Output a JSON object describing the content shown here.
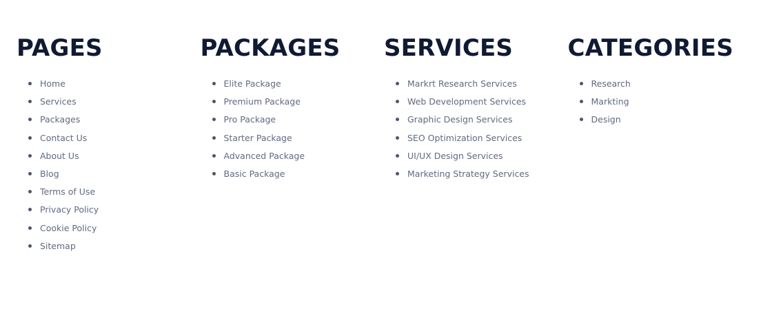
{
  "columns": [
    {
      "title": "PAGES",
      "items": [
        "Home",
        "Services",
        "Packages",
        "Contact Us",
        "About Us",
        "Blog",
        "Terms of Use",
        "Privacy Policy",
        "Cookie Policy",
        "Sitemap"
      ]
    },
    {
      "title": "PACKAGES",
      "items": [
        "Elite Package",
        "Premium Package",
        "Pro Package",
        "Starter Package",
        "Advanced Package",
        "Basic Package"
      ]
    },
    {
      "title": "SERVICES",
      "items": [
        "Markrt Research Services",
        "Web Development Services",
        "Graphic Design Services",
        "SEO Optimization Services",
        "UI/UX Design Services",
        "Marketing Strategy Services"
      ]
    },
    {
      "title": "CATEGORIES",
      "items": [
        "Research",
        "Markting",
        "Design"
      ]
    }
  ],
  "colors": {
    "heading": "#101a33",
    "link": "#5f6a80",
    "bullet": "#4a5570",
    "background": "#ffffff"
  }
}
